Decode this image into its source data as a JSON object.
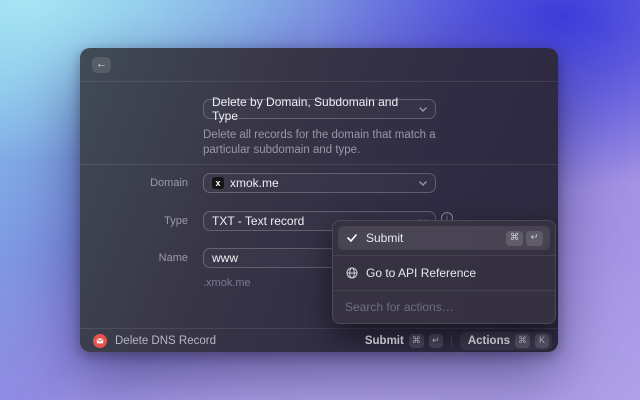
{
  "window": {
    "header": {
      "back_icon": "←"
    },
    "mode_select": {
      "value": "Delete by Domain, Subdomain and Type"
    },
    "description": "Delete all records for the domain that match a particular subdomain and type.",
    "form": {
      "domain": {
        "label": "Domain",
        "favicon_letter": "x",
        "value": "xmok.me"
      },
      "type": {
        "label": "Type",
        "value": "TXT - Text record"
      },
      "name": {
        "label": "Name",
        "value": "www",
        "hint": ".xmok.me"
      }
    },
    "actions_popup": {
      "submit_item": {
        "label": "Submit",
        "shortcut": [
          "⌘",
          "↵"
        ]
      },
      "api_item": {
        "label": "Go to API Reference"
      },
      "search_placeholder": "Search for actions…"
    },
    "status_bar": {
      "command_name": "Delete DNS Record",
      "primary_action": {
        "label": "Submit",
        "shortcut": [
          "⌘",
          "↵"
        ]
      },
      "actions_button": {
        "label": "Actions",
        "shortcut": [
          "⌘",
          "K"
        ]
      }
    }
  },
  "colors": {
    "accent_red": "#e4544e",
    "window_bg": "#332f44",
    "popup_bg": "#363242",
    "bg_top_left": "#a6e4f4",
    "bg_top_right": "#3d3ddb",
    "bg_bottom": "#ab9de8"
  }
}
